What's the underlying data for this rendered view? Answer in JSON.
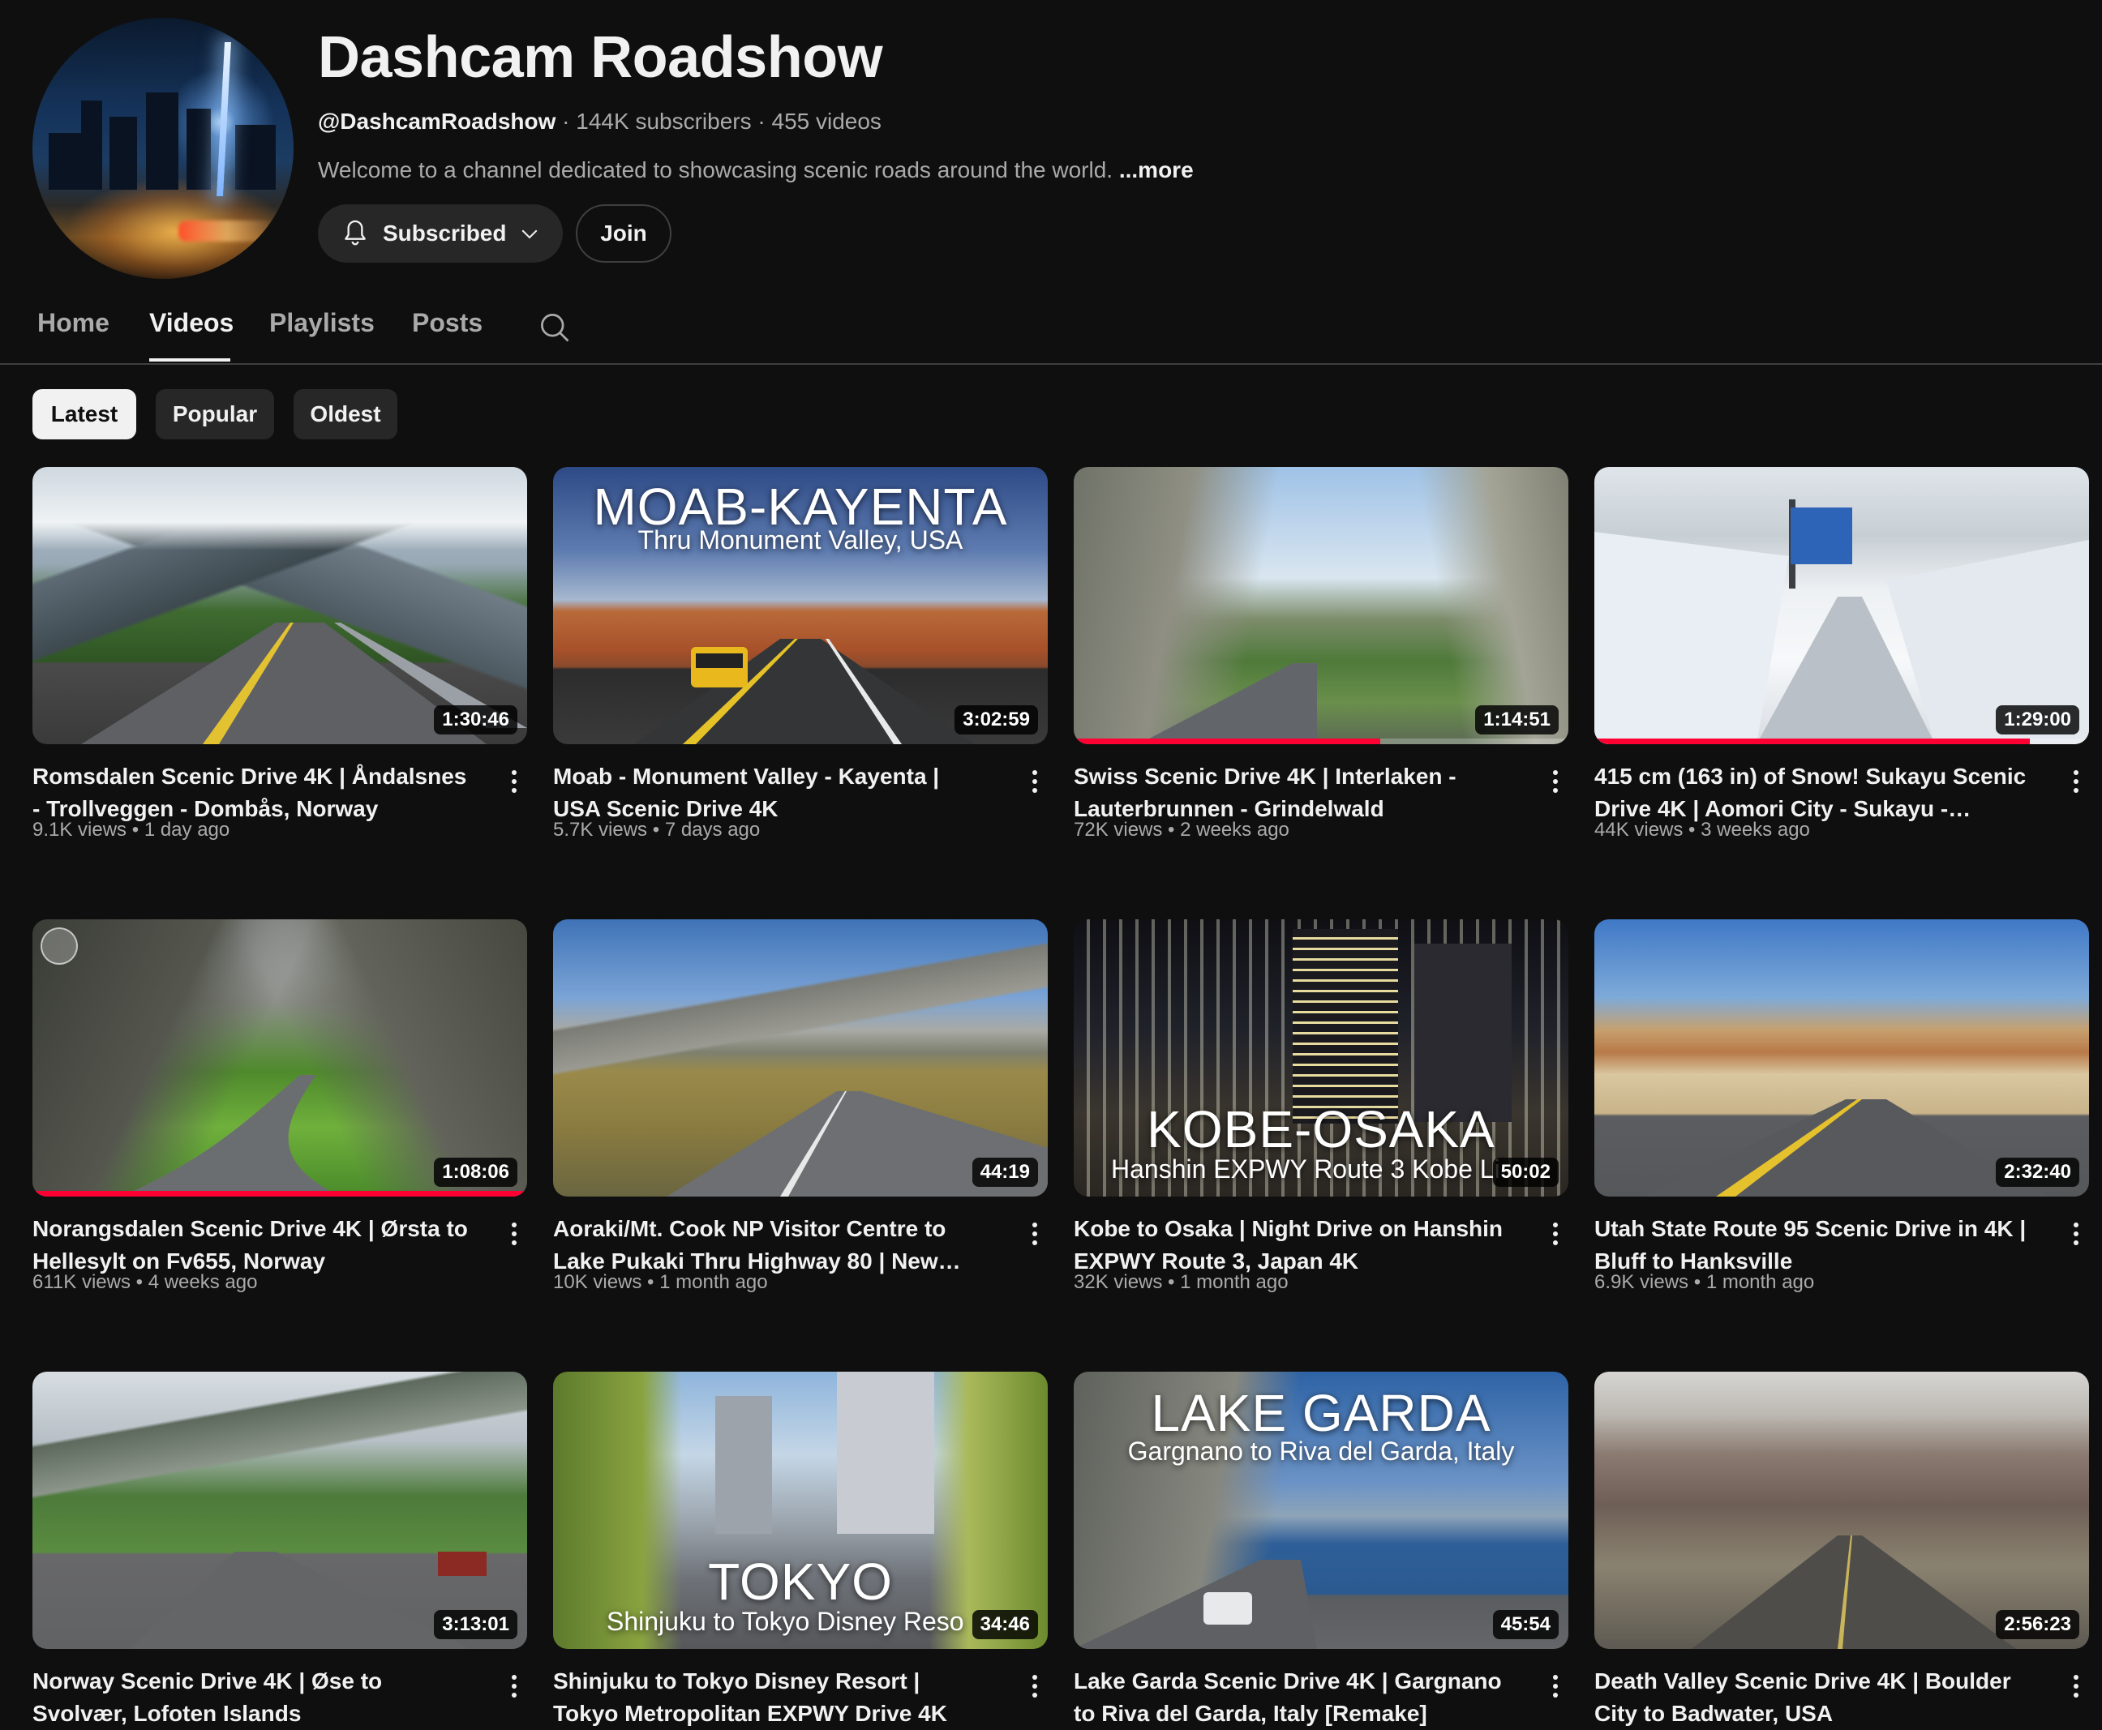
{
  "channel": {
    "name": "Dashcam Roadshow",
    "handle": "@DashcamRoadshow",
    "subscribers": "144K subscribers",
    "video_count": "455 videos",
    "separator": "·",
    "description": "Welcome to a channel dedicated to showcasing scenic roads around the world.",
    "more_label": "...more",
    "subscribed_label": "Subscribed",
    "join_label": "Join"
  },
  "tabs": [
    {
      "label": "Home"
    },
    {
      "label": "Videos",
      "active": true
    },
    {
      "label": "Playlists"
    },
    {
      "label": "Posts"
    }
  ],
  "filters": [
    {
      "label": "Latest",
      "active": true
    },
    {
      "label": "Popular"
    },
    {
      "label": "Oldest"
    }
  ],
  "videos": [
    {
      "title": "Romsdalen Scenic Drive 4K | Åndalsnes - Trollveggen - Dombås, Norway",
      "views": "9.1K views",
      "age": "1 day ago",
      "duration": "1:30:46"
    },
    {
      "title": "Moab - Monument Valley - Kayenta | USA Scenic Drive 4K",
      "views": "5.7K views",
      "age": "7 days ago",
      "duration": "3:02:59",
      "overlay_title": "MOAB-KAYENTA",
      "overlay_subtitle": "Thru Monument Valley, USA"
    },
    {
      "title": "Swiss Scenic Drive 4K | Interlaken - Lauterbrunnen - Grindelwald",
      "views": "72K views",
      "age": "2 weeks ago",
      "duration": "1:14:51",
      "watched": 0.62
    },
    {
      "title": "415 cm (163 in) of Snow! Sukayu Scenic Drive 4K | Aomori City - Sukayu - Tsugaru S...",
      "views": "44K views",
      "age": "3 weeks ago",
      "duration": "1:29:00",
      "watched": 0.88
    },
    {
      "title": "Norangsdalen Scenic Drive 4K | Ørsta to Hellesylt on Fv655, Norway",
      "views": "611K views",
      "age": "4 weeks ago",
      "duration": "1:08:06",
      "watched": 1.0
    },
    {
      "title": "Aoraki/Mt. Cook NP Visitor Centre to Lake Pukaki Thru Highway 80 | New Zealand...",
      "views": "10K views",
      "age": "1 month ago",
      "duration": "44:19"
    },
    {
      "title": "Kobe to Osaka | Night Drive on Hanshin EXPWY Route 3, Japan 4K",
      "views": "32K views",
      "age": "1 month ago",
      "duration": "50:02",
      "overlay_title": "KOBE-OSAKA",
      "overlay_subtitle": "Hanshin EXPWY Route 3 Kobe Li"
    },
    {
      "title": "Utah State Route 95 Scenic Drive in 4K | Bluff to Hanksville",
      "views": "6.9K views",
      "age": "1 month ago",
      "duration": "2:32:40"
    },
    {
      "title": "Norway Scenic Drive 4K | Øse to Svolvær, Lofoten Islands",
      "views": "",
      "age": "",
      "duration": "3:13:01"
    },
    {
      "title": "Shinjuku to Tokyo Disney Resort | Tokyo Metropolitan EXPWY Drive 4K",
      "views": "",
      "age": "",
      "duration": "34:46",
      "overlay_title": "TOKYO",
      "overlay_subtitle": "Shinjuku to Tokyo Disney Reso"
    },
    {
      "title": "Lake Garda Scenic Drive 4K | Gargnano to Riva del Garda, Italy [Remake]",
      "views": "",
      "age": "",
      "duration": "45:54",
      "overlay_title": "LAKE GARDA",
      "overlay_subtitle": "Gargnano to Riva del Garda, Italy"
    },
    {
      "title": "Death Valley Scenic Drive 4K | Boulder City to Badwater, USA",
      "views": "",
      "age": "",
      "duration": "2:56:23"
    }
  ],
  "icons": {
    "bell": "bell-icon",
    "chevron": "chevron-down-icon",
    "search": "search-icon",
    "more": "more-vert-icon"
  },
  "colors": {
    "background": "#0f0f0f",
    "progress": "#ff0033",
    "chip": "#272727",
    "chip_active": "#f1f1f1"
  }
}
